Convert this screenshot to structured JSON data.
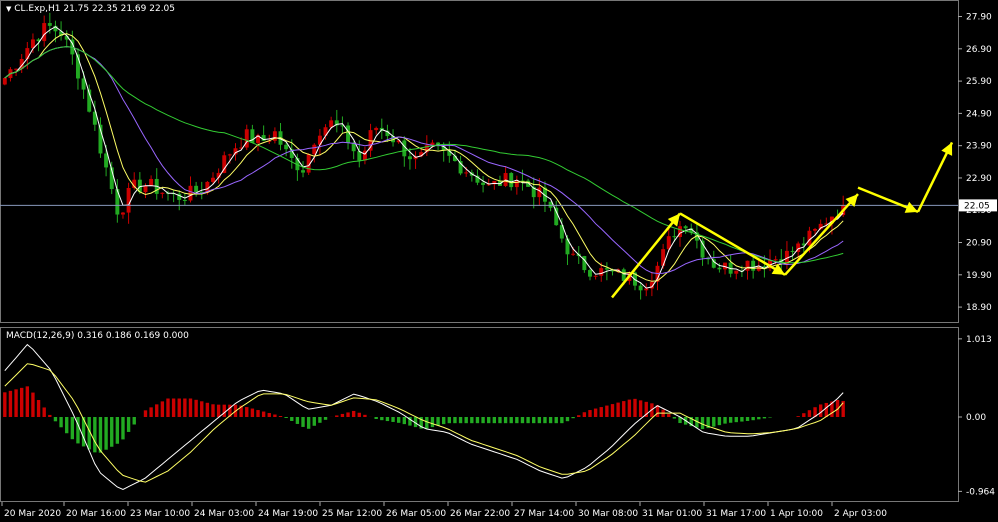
{
  "symbol_header": "CL.Exp,H1  21.75 22.35 21.69 22.05",
  "macd_header": "MACD(12,26,9) 0.316 0.186 0.169 0.000",
  "current_price_label": "22.05",
  "colors": {
    "background": "#000000",
    "bull": "#cc0000",
    "bear": "#22aa22",
    "ma_fast": "#ffffff",
    "ma_mid": "#ffff66",
    "ma_slow": "#9966ff",
    "ma_long": "#33cc33",
    "arrow": "#ffff00",
    "hline": "#8899bb"
  },
  "chart_data": [
    {
      "type": "candlestick",
      "title": "CL.Exp,H1",
      "ylim": [
        18.5,
        28.35
      ],
      "y_ticks": [
        "27.90",
        "26.90",
        "25.90",
        "24.90",
        "23.90",
        "22.90",
        "21.90",
        "20.90",
        "19.90",
        "18.90"
      ],
      "x_ticks": [
        "20 Mar 2020",
        "20 Mar 16:00",
        "23 Mar 10:00",
        "24 Mar 03:00",
        "24 Mar 19:00",
        "25 Mar 12:00",
        "26 Mar 05:00",
        "26 Mar 22:00",
        "27 Mar 14:00",
        "30 Mar 08:00",
        "31 Mar 01:00",
        "31 Mar 17:00",
        "1 Apr 10:00",
        "2 Apr 03:00"
      ],
      "close_path": [
        26.0,
        26.6,
        27.2,
        27.6,
        27.4,
        26.4,
        25.0,
        23.4,
        21.8,
        22.6,
        22.7,
        22.5,
        22.3,
        22.4,
        22.6,
        23.2,
        23.8,
        24.2,
        24.0,
        24.3,
        23.5,
        23.2,
        24.4,
        24.6,
        24.2,
        23.4,
        24.5,
        24.3,
        23.8,
        23.4,
        23.8,
        23.6,
        23.3,
        23.0,
        22.6,
        22.8,
        22.9,
        22.6,
        22.2,
        21.2,
        20.4,
        20.1,
        20.0,
        19.9,
        19.8,
        19.6,
        20.2,
        21.2,
        21.6,
        20.7,
        20.2,
        20.1,
        20.3,
        20.2,
        20.4,
        20.5,
        20.8,
        21.2,
        21.7,
        22.05
      ],
      "last_ohlc": {
        "open": 21.75,
        "high": 22.35,
        "low": 21.69,
        "close": 22.05
      },
      "last_price": 22.05,
      "annotation_arrows_prices": [
        [
          19.2,
          21.8
        ],
        [
          21.8,
          19.9
        ],
        [
          19.9,
          22.4
        ],
        [
          22.6,
          21.85
        ],
        [
          21.85,
          24.0
        ]
      ]
    },
    {
      "type": "histogram+lines",
      "title": "MACD(12,26,9)",
      "values": {
        "main": 0.316,
        "signal": 0.186,
        "v3": 0.169,
        "v4": 0.0
      },
      "ylim": [
        -1.05,
        1.05
      ],
      "y_ticks": [
        "1.013",
        "0.00",
        "-0.964"
      ],
      "macd_path": [
        0.6,
        0.95,
        0.6,
        0.0,
        -0.7,
        -0.95,
        -0.8,
        -0.55,
        -0.3,
        -0.05,
        0.2,
        0.35,
        0.3,
        0.1,
        0.15,
        0.3,
        0.2,
        0.05,
        -0.15,
        -0.2,
        -0.35,
        -0.45,
        -0.55,
        -0.7,
        -0.8,
        -0.65,
        -0.4,
        -0.1,
        0.15,
        0.0,
        -0.2,
        -0.25,
        -0.25,
        -0.2,
        -0.15,
        0.05,
        0.3
      ],
      "signal_path": [
        0.4,
        0.7,
        0.6,
        0.2,
        -0.4,
        -0.75,
        -0.85,
        -0.7,
        -0.45,
        -0.15,
        0.1,
        0.3,
        0.3,
        0.2,
        0.15,
        0.25,
        0.22,
        0.1,
        -0.05,
        -0.15,
        -0.3,
        -0.4,
        -0.5,
        -0.65,
        -0.75,
        -0.7,
        -0.5,
        -0.25,
        0.05,
        0.05,
        -0.1,
        -0.2,
        -0.22,
        -0.2,
        -0.15,
        -0.05,
        0.15
      ]
    }
  ]
}
